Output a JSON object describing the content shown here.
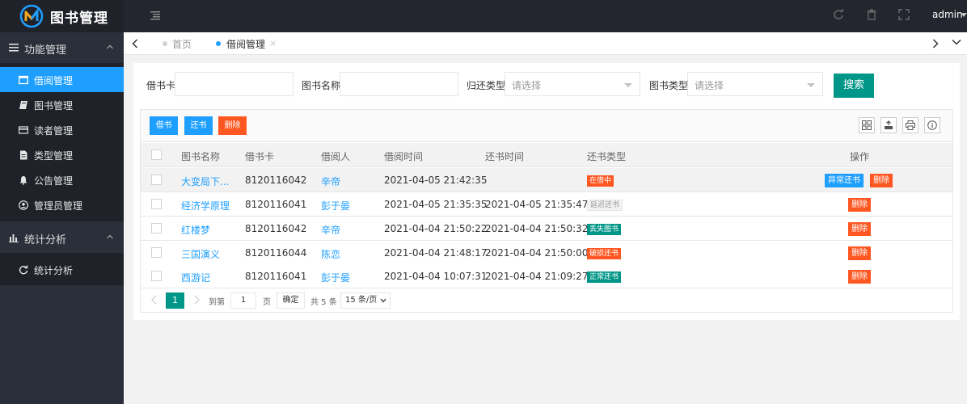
{
  "app": {
    "title": "图书管理",
    "user": "admin"
  },
  "colors": {
    "primary": "#1e9fff",
    "accent": "#009688",
    "danger": "#ff5722",
    "sidebar_bg": "#2b2f3a",
    "topbar_bg": "#23262e"
  },
  "sidebar": {
    "groups": [
      {
        "label": "功能管理",
        "icon": "menu-icon"
      },
      {
        "label": "统计分析",
        "icon": "bar-chart-icon"
      }
    ],
    "items": [
      {
        "label": "借阅管理",
        "icon": "window-icon",
        "active": true
      },
      {
        "label": "图书管理",
        "icon": "book-icon"
      },
      {
        "label": "读者管理",
        "icon": "card-icon"
      },
      {
        "label": "类型管理",
        "icon": "file-icon"
      },
      {
        "label": "公告管理",
        "icon": "bell-icon"
      },
      {
        "label": "管理员管理",
        "icon": "user-circle-icon"
      }
    ],
    "stats_items": [
      {
        "label": "统计分析",
        "icon": "refresh-icon"
      }
    ]
  },
  "tabs": [
    {
      "label": "首页",
      "active": false
    },
    {
      "label": "借阅管理",
      "active": true,
      "close": "×"
    }
  ],
  "search": {
    "card_label": "借书卡",
    "card_value": "",
    "book_label": "图书名称",
    "book_value": "",
    "return_type_label": "归还类型",
    "return_type_placeholder": "请选择",
    "book_type_label": "图书类型",
    "book_type_placeholder": "请选择",
    "button": "搜索"
  },
  "toolbar": {
    "borrow": "借书",
    "return": "还书",
    "delete": "删除"
  },
  "table": {
    "columns": [
      "图书名称",
      "借书卡",
      "借阅人",
      "借阅时间",
      "还书时间",
      "还书类型",
      "操作"
    ],
    "rows": [
      {
        "book": "大变局下...",
        "card": "8120116042",
        "reader": "辛帝",
        "borrow_time": "2021-04-05 21:42:35",
        "return_time": "",
        "type": "在借中",
        "type_color": "orange",
        "abnormal": "异常还书",
        "delete": "删除"
      },
      {
        "book": "经济学原理",
        "card": "8120116041",
        "reader": "彭于晏",
        "borrow_time": "2021-04-05 21:35:35",
        "return_time": "2021-04-05 21:35:47",
        "type": "延迟还书",
        "type_color": "gray",
        "delete": "删除"
      },
      {
        "book": "红楼梦",
        "card": "8120116042",
        "reader": "辛帝",
        "borrow_time": "2021-04-04 21:50:22",
        "return_time": "2021-04-04 21:50:32",
        "type": "丢失图书",
        "type_color": "green",
        "delete": "删除"
      },
      {
        "book": "三国演义",
        "card": "8120116044",
        "reader": "陈恋",
        "borrow_time": "2021-04-04 21:48:17",
        "return_time": "2021-04-04 21:50:00",
        "type": "破损还书",
        "type_color": "orange",
        "delete": "删除"
      },
      {
        "book": "西游记",
        "card": "8120116041",
        "reader": "彭于晏",
        "borrow_time": "2021-04-04 10:07:31",
        "return_time": "2021-04-04 21:09:27",
        "type": "正常还书",
        "type_color": "green",
        "delete": "删除"
      }
    ]
  },
  "pagination": {
    "current": "1",
    "goto_label": "到第",
    "goto_value": "1",
    "page_label": "页",
    "confirm": "确定",
    "total": "共 5 条",
    "page_size": "15 条/页"
  }
}
